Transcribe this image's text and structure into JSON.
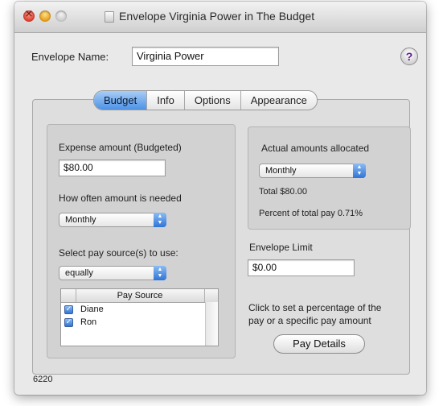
{
  "window": {
    "title": "Envelope Virginia Power in The Budget"
  },
  "envelope_name": {
    "label": "Envelope Name:",
    "value": "Virginia Power"
  },
  "help": {
    "label": "?"
  },
  "tabs": [
    {
      "label": "Budget",
      "active": true
    },
    {
      "label": "Info",
      "active": false
    },
    {
      "label": "Options",
      "active": false
    },
    {
      "label": "Appearance",
      "active": false
    }
  ],
  "budget": {
    "expense_label": "Expense amount (Budgeted)",
    "expense_value": "$80.00",
    "how_often_label": "How often amount is needed",
    "how_often_value": "Monthly",
    "pay_source_label": "Select pay source(s) to use:",
    "pay_source_value": "equally",
    "table": {
      "header": "Pay Source",
      "rows": [
        {
          "checked": true,
          "name": "Diane"
        },
        {
          "checked": true,
          "name": "Ron"
        }
      ]
    }
  },
  "actual": {
    "title": "Actual amounts allocated",
    "period_value": "Monthly",
    "total_text": "Total  $80.00",
    "percent_text": "Percent of total pay  0.71%"
  },
  "limit": {
    "label": "Envelope Limit",
    "value": "$0.00"
  },
  "pay_details": {
    "hint_line1": "Click to set a percentage of the",
    "hint_line2": "pay or a specific pay amount",
    "button_label": "Pay Details"
  },
  "footer": {
    "id_text": "6220"
  },
  "colors": {
    "accent": "#4d92e6",
    "window_bg": "#e9e9e9",
    "group_bg": "#d2d2d2",
    "help_glyph": "#5a1a8c"
  },
  "icons": {
    "close": "close-icon",
    "minimize": "minimize-icon",
    "zoom": "zoom-icon",
    "title_doc": "document-icon",
    "help": "help-icon",
    "popup_arrows": "updown-arrows-icon",
    "checkbox": "checkmark-icon"
  }
}
